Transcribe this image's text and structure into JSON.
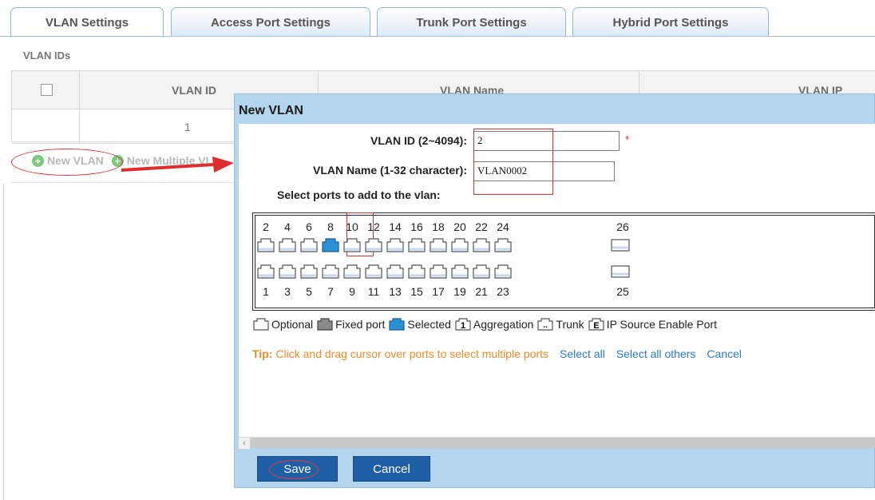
{
  "tabs": [
    {
      "label": "VLAN Settings",
      "active": true
    },
    {
      "label": "Access Port Settings",
      "active": false
    },
    {
      "label": "Trunk Port Settings",
      "active": false
    },
    {
      "label": "Hybrid Port Settings",
      "active": false
    }
  ],
  "section_label": "VLAN IDs",
  "table": {
    "columns": [
      "VLAN ID",
      "VLAN Name",
      "VLAN IP"
    ],
    "rows": [
      {
        "vlan_id": "1"
      }
    ]
  },
  "actions": {
    "new_vlan": "New VLAN",
    "new_multiple": "New Multiple VL"
  },
  "dialog": {
    "title": "New VLAN",
    "vlan_id_label": "VLAN ID (2~4094):",
    "vlan_id_value": "2",
    "required_mark": "*",
    "vlan_name_label": "VLAN Name (1-32 character):",
    "vlan_name_value": "VLAN0002",
    "select_ports_label": "Select ports to add to the vlan:",
    "ports": {
      "top": [
        "2",
        "4",
        "6",
        "8",
        "10",
        "12",
        "14",
        "16",
        "18",
        "20",
        "22",
        "24",
        "26"
      ],
      "bottom": [
        "1",
        "3",
        "5",
        "7",
        "9",
        "11",
        "13",
        "15",
        "17",
        "19",
        "21",
        "23",
        "25"
      ],
      "selected": [
        "8"
      ]
    },
    "legend": {
      "optional": "Optional",
      "fixed": "Fixed port",
      "selected": "Selected",
      "aggregation": "Aggregation",
      "aggregation_glyph": "1",
      "trunk": "Trunk",
      "trunk_glyph": "..",
      "ip_source": "IP Source Enable Port",
      "ip_source_glyph": "E"
    },
    "tip_label": "Tip:",
    "tip_text": "Click and drag cursor over ports to select multiple ports",
    "select_all": "Select all",
    "select_all_others": "Select all others",
    "cancel_link": "Cancel",
    "save_button": "Save",
    "cancel_button": "Cancel"
  },
  "colors": {
    "dialog_bg": "#b4d5ee",
    "button_blue": "#1f5fa6",
    "port_selected": "#2b8fd6",
    "annotation_red": "#d93030",
    "tip_orange": "#f08a24",
    "link_blue": "#2b78c5"
  }
}
